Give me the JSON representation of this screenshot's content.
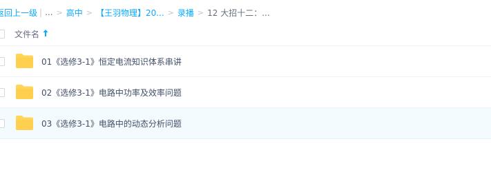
{
  "breadcrumb": {
    "back_label": "返回上一级",
    "ellipsis": "...",
    "items": [
      {
        "label": "高中"
      },
      {
        "label": "【王羽物理】20..."
      },
      {
        "label": "录播"
      }
    ],
    "current": "12 大招十二：..."
  },
  "header": {
    "name_column": "文件名",
    "sort_icon": "sort-up-arrow-icon"
  },
  "files": [
    {
      "name": "01《选修3-1》恒定电流知识体系串讲",
      "icon": "folder-icon"
    },
    {
      "name": "02《选修3-1》电路中功率及效率问题",
      "icon": "folder-icon"
    },
    {
      "name": "03《选修3-1》电路中的动态分析问题",
      "icon": "folder-icon"
    }
  ],
  "colors": {
    "accent": "#09aaff",
    "folder": "#ffd659",
    "hover_row": "#f4fbff"
  }
}
